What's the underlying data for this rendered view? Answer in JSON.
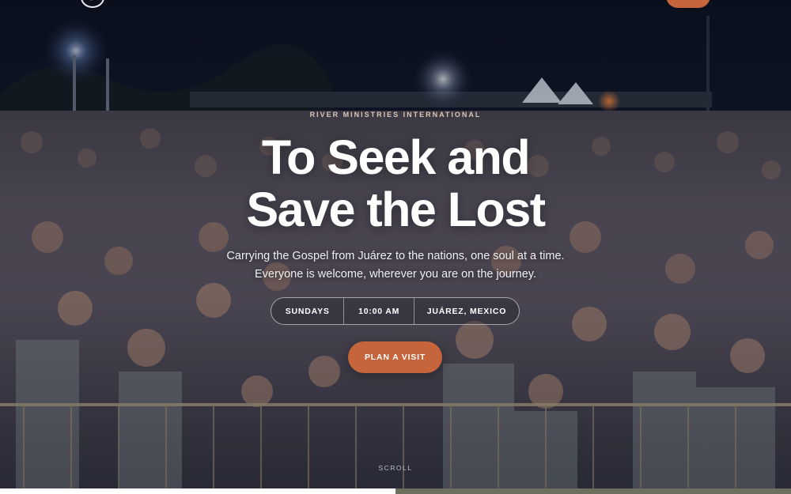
{
  "hero": {
    "eyebrow": "RIVER MINISTRIES INTERNATIONAL",
    "title_line1": "To Seek and",
    "title_line2": "Save the Lost",
    "subtitle_line1": "Carrying the Gospel from Juárez to the nations, one soul at a time.",
    "subtitle_line2": "Everyone is welcome, wherever you are on the journey.",
    "info": {
      "day": "SUNDAYS",
      "time": "10:00 AM",
      "location": "JUÁREZ, MEXICO"
    },
    "cta_label": "PLAN A VISIT",
    "scroll_label": "SCROLL"
  },
  "colors": {
    "accent": "#c6643c",
    "eyebrow": "#d9c6b6",
    "text": "#ffffff"
  },
  "icons": {
    "logo": "ministry-logo-icon"
  }
}
